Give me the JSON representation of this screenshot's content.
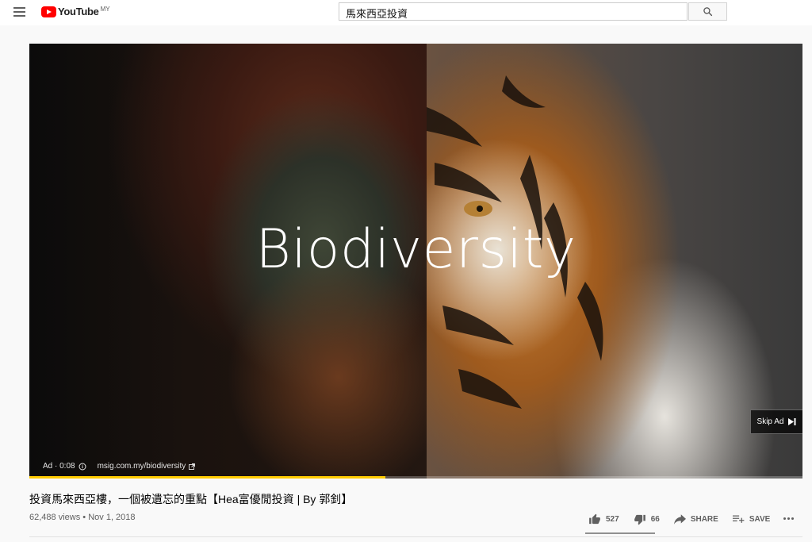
{
  "header": {
    "logo_text": "YouTube",
    "country_code": "MY",
    "search_value": "馬來西亞投資"
  },
  "player": {
    "overlay_text": "Biodiversity",
    "ad_label": "Ad · 0:08",
    "ad_url": "msig.com.my/biodiversity",
    "skip_label": "Skip Ad",
    "progress_fraction": 0.46
  },
  "video": {
    "title": "投資馬來西亞樓，一個被遺忘的重點【Hea富優閒投資 | By 郭釗】",
    "views": "62,488 views",
    "date": "Nov 1, 2018"
  },
  "actions": {
    "likes": "527",
    "dislikes": "66",
    "share_label": "SHARE",
    "save_label": "SAVE"
  }
}
